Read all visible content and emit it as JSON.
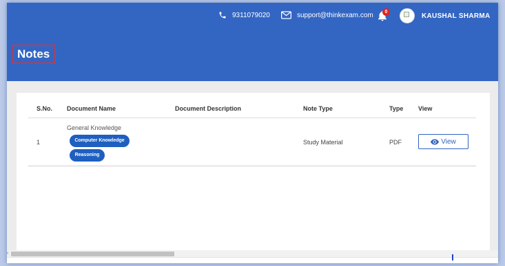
{
  "header": {
    "phone": "9311079020",
    "email": "support@thinkexam.com",
    "notification_count": "0",
    "user_name": "KAUSHAL SHARMA",
    "page_title": "Notes",
    "colors": {
      "primary": "#3366c3",
      "badge": "#e02424",
      "chip": "#1e5fc0"
    }
  },
  "table": {
    "columns": [
      "S.No.",
      "Document Name",
      "Document Description",
      "Note Type",
      "Type",
      "View"
    ],
    "rows": [
      {
        "sno": "1",
        "document_name": "General Knowledge",
        "tags": [
          "Computer Knowledge",
          "Reasoning"
        ],
        "description": "",
        "note_type": "Study Material",
        "type": "PDF",
        "view_label": "View"
      }
    ]
  },
  "icons": {
    "phone": "phone-icon",
    "mail": "mail-icon",
    "bell": "bell-icon",
    "eye": "eye-icon"
  }
}
